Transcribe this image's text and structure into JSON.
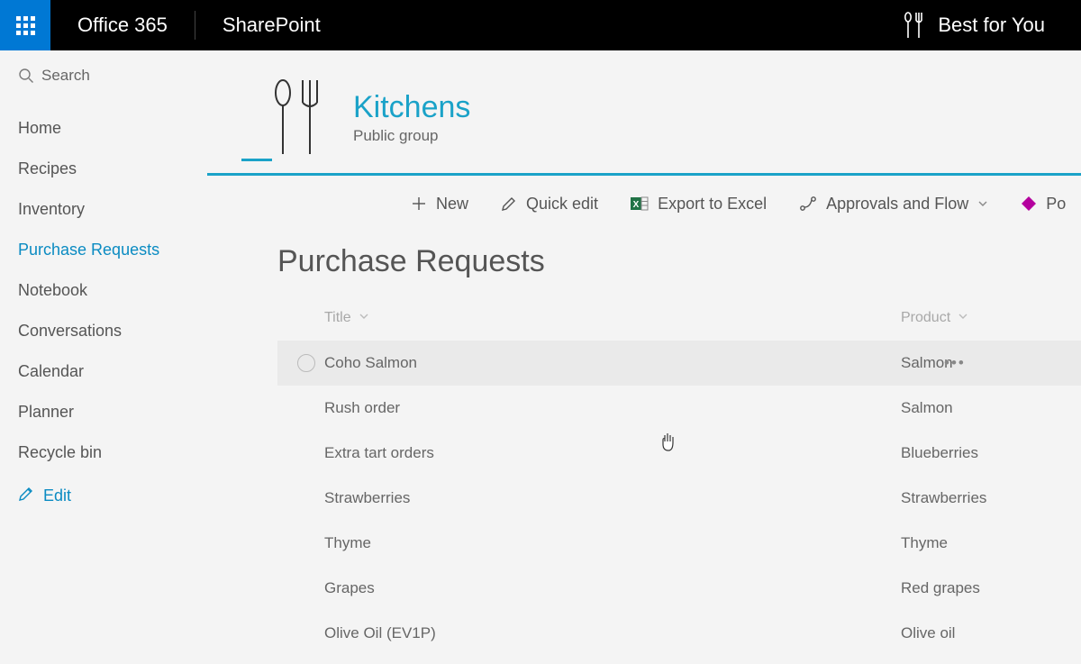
{
  "topbar": {
    "suite_title": "Office 365",
    "app_name": "SharePoint",
    "brand_text": "Best for You"
  },
  "search": {
    "placeholder": "Search"
  },
  "nav": {
    "items": [
      {
        "label": "Home"
      },
      {
        "label": "Recipes"
      },
      {
        "label": "Inventory"
      },
      {
        "label": "Purchase Requests"
      },
      {
        "label": "Notebook"
      },
      {
        "label": "Conversations"
      },
      {
        "label": "Calendar"
      },
      {
        "label": "Planner"
      },
      {
        "label": "Recycle bin"
      }
    ],
    "active_index": 3,
    "edit_label": "Edit"
  },
  "site": {
    "title": "Kitchens",
    "subtitle": "Public group"
  },
  "commands": {
    "new": "New",
    "quick_edit": "Quick edit",
    "export": "Export to Excel",
    "approvals": "Approvals and Flow",
    "power": "Po"
  },
  "list": {
    "title": "Purchase Requests",
    "columns": {
      "title": "Title",
      "product": "Product"
    },
    "hovered_index": 0,
    "rows": [
      {
        "title": "Coho Salmon",
        "product": "Salmon"
      },
      {
        "title": "Rush order",
        "product": "Salmon"
      },
      {
        "title": "Extra tart orders",
        "product": "Blueberries"
      },
      {
        "title": "Strawberries",
        "product": "Strawberries"
      },
      {
        "title": "Thyme",
        "product": "Thyme"
      },
      {
        "title": "Grapes",
        "product": "Red grapes"
      },
      {
        "title": "Olive Oil (EV1P)",
        "product": "Olive oil"
      }
    ]
  }
}
